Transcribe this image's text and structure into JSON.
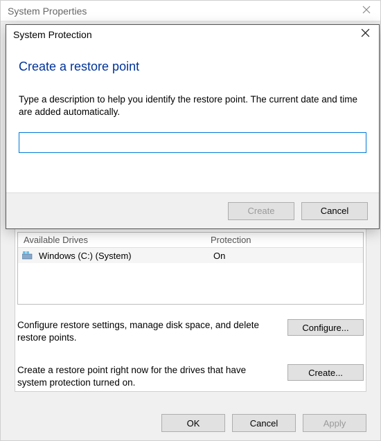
{
  "bg_window": {
    "title": "System Properties",
    "drives": {
      "header_drive": "Available Drives",
      "header_protection": "Protection",
      "rows": [
        {
          "name": "Windows (C:) (System)",
          "protection": "On"
        }
      ]
    },
    "configure": {
      "text": "Configure restore settings, manage disk space, and delete restore points.",
      "button": "Configure..."
    },
    "create": {
      "text": "Create a restore point right now for the drives that have system protection turned on.",
      "button": "Create..."
    },
    "buttons": {
      "ok": "OK",
      "cancel": "Cancel",
      "apply": "Apply"
    }
  },
  "dialog": {
    "title": "System Protection",
    "heading": "Create a restore point",
    "description": "Type a description to help you identify the restore point. The current date and time are added automatically.",
    "input_value": "",
    "buttons": {
      "create": "Create",
      "cancel": "Cancel"
    }
  }
}
